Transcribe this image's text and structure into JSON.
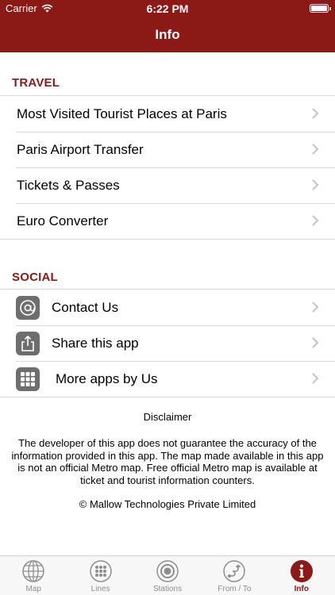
{
  "status_bar": {
    "carrier": "Carrier",
    "time": "6:22 PM",
    "battery_level": 1.0
  },
  "nav": {
    "title": "Info"
  },
  "travel": {
    "header": "TRAVEL",
    "items": [
      {
        "label": "Most Visited Tourist Places at Paris"
      },
      {
        "label": "Paris Airport Transfer"
      },
      {
        "label": "Tickets & Passes"
      },
      {
        "label": "Euro Converter"
      }
    ]
  },
  "social": {
    "header": "SOCIAL",
    "items": [
      {
        "label": "Contact Us",
        "icon": "at-icon"
      },
      {
        "label": "Share this app",
        "icon": "share-icon"
      },
      {
        "label": "More apps by Us",
        "icon": "grid-icon"
      }
    ]
  },
  "disclaimer": {
    "title": "Disclaimer",
    "text": "The developer of this app does not guarantee the accuracy of the information provided in this app. The map made available in this app is not an official Metro map. Free official Metro map is available at ticket and tourist information counters.",
    "copyright": "© Mallow Technologies Private Limited"
  },
  "tabs": [
    {
      "label": "Map",
      "icon": "globe-icon",
      "active": false
    },
    {
      "label": "Lines",
      "icon": "dots-grid-icon",
      "active": false
    },
    {
      "label": "Stations",
      "icon": "target-icon",
      "active": false
    },
    {
      "label": "From / To",
      "icon": "route-icon",
      "active": false
    },
    {
      "label": "Info",
      "icon": "info-icon",
      "active": true
    }
  ],
  "colors": {
    "brand": "#8b1a16",
    "separator": "#d9d9d9",
    "icon_gray": "#6e6e6e",
    "tab_inactive": "#8e8e8e"
  }
}
